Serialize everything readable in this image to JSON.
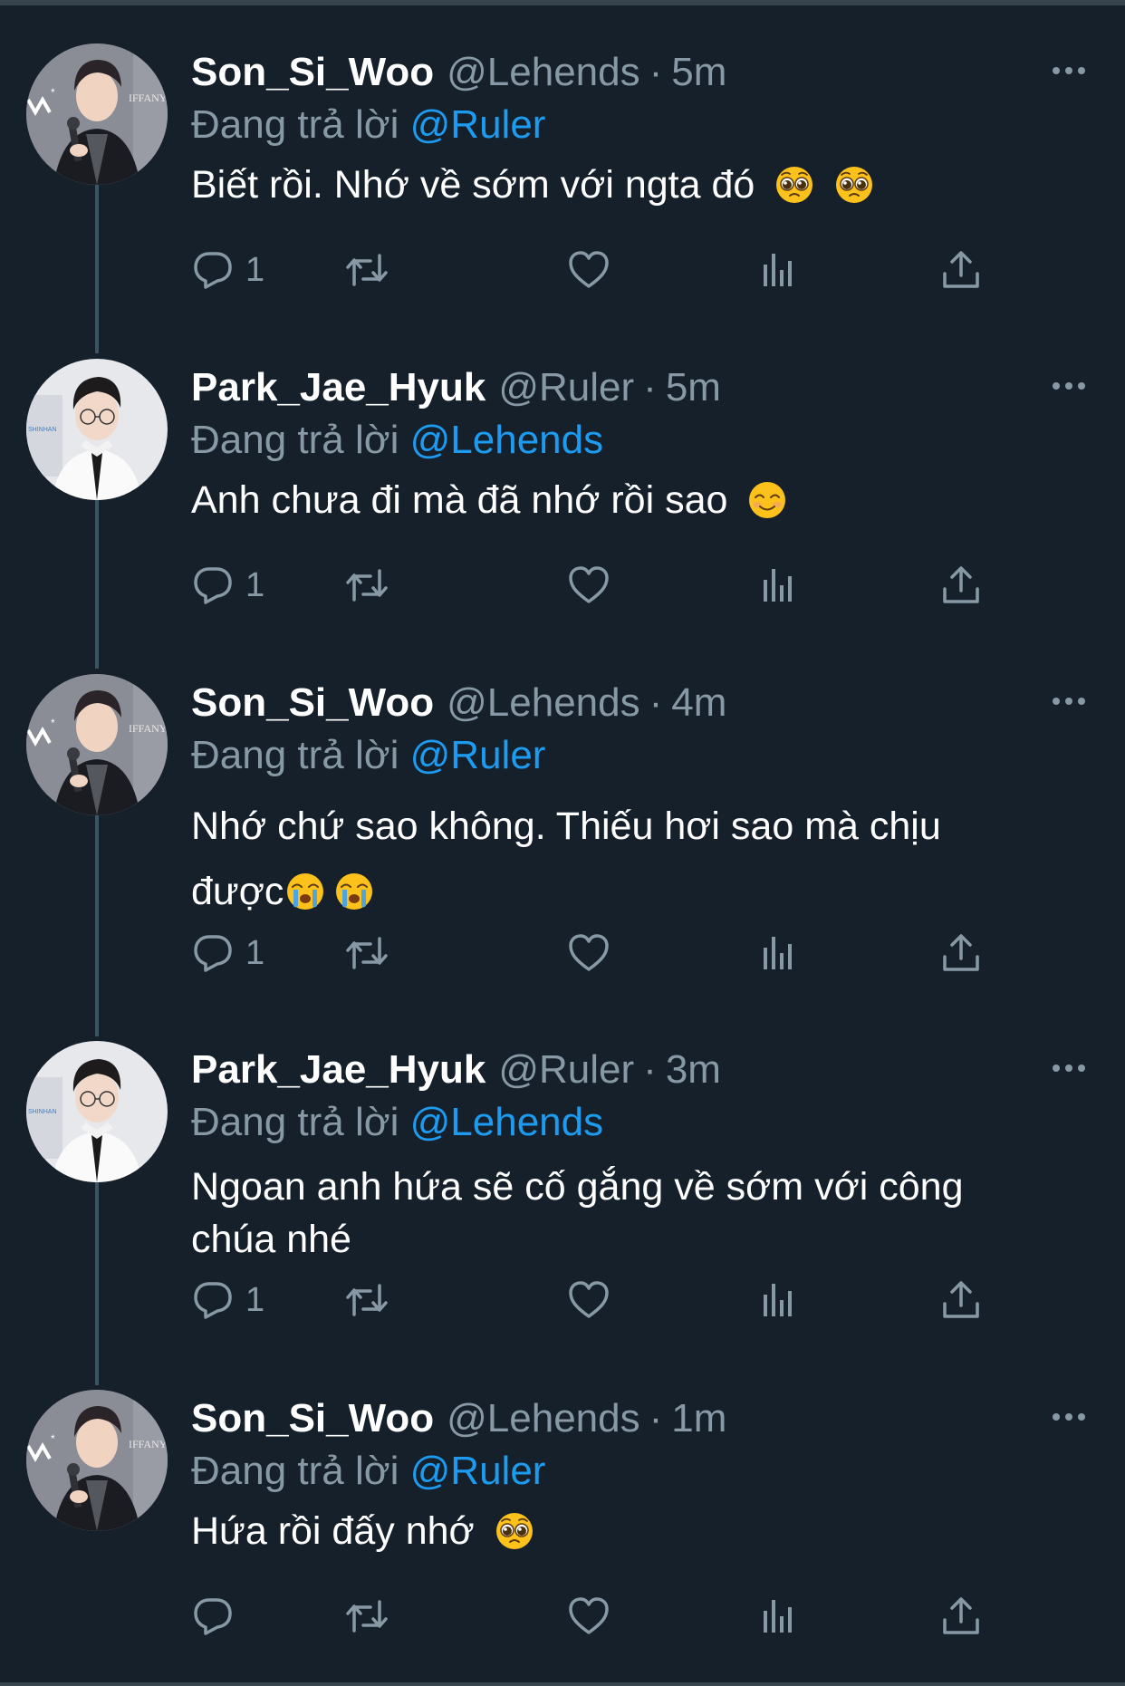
{
  "colors": {
    "background": "#15202b",
    "text": "#ffffff",
    "secondary": "#8899a6",
    "link": "#1d9bf0",
    "thread_line": "#3d5466"
  },
  "reply_prefix": "Đang trả lời",
  "icons": [
    "more-icon",
    "reply-icon",
    "retweet-icon",
    "like-icon",
    "analytics-icon",
    "share-icon"
  ],
  "tweets": [
    {
      "author": "Son_Si_Woo",
      "handle": "@Lehends",
      "sep": "·",
      "time": "5m",
      "reply_to": "@Ruler",
      "text": "Biết rồi. Nhớ về sớm với ngta đó",
      "emojis": [
        "pleading-face-emoji",
        "pleading-face-emoji"
      ],
      "reply_count": "1"
    },
    {
      "author": "Park_Jae_Hyuk",
      "handle": "@Ruler",
      "sep": "·",
      "time": "5m",
      "reply_to": "@Lehends",
      "text": "Anh chưa đi mà đã nhớ rồi sao",
      "emojis": [
        "smiling-face-emoji"
      ],
      "reply_count": "1"
    },
    {
      "author": "Son_Si_Woo",
      "handle": "@Lehends",
      "sep": "·",
      "time": "4m",
      "reply_to": "@Ruler",
      "text_line1": "Nhớ chứ sao không. Thiếu hơi sao mà chịu",
      "text_line2": "được",
      "emojis": [
        "crying-face-emoji",
        "crying-face-emoji"
      ],
      "reply_count": "1"
    },
    {
      "author": "Park_Jae_Hyuk",
      "handle": "@Ruler",
      "sep": "·",
      "time": "3m",
      "reply_to": "@Lehends",
      "text_line1": "Ngoan anh hứa sẽ cố gắng về sớm với công",
      "text_line2": "chúa nhé",
      "reply_count": "1"
    },
    {
      "author": "Son_Si_Woo",
      "handle": "@Lehends",
      "sep": "·",
      "time": "1m",
      "reply_to": "@Ruler",
      "text": "Hứa rồi đấy nhớ",
      "emojis": [
        "pleading-face-emoji"
      ],
      "reply_count": ""
    }
  ]
}
